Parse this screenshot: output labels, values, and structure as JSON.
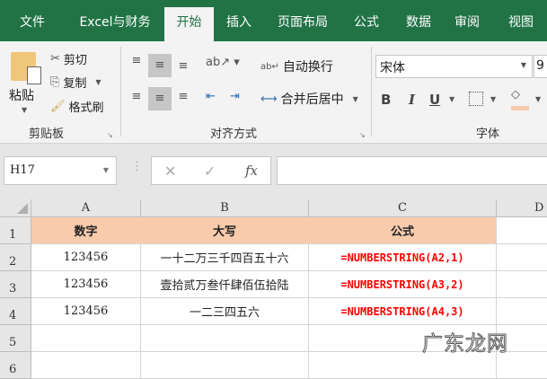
{
  "tabs": [
    "文件",
    "Excel与财务",
    "开始",
    "插入",
    "页面布局",
    "公式",
    "数据",
    "审阅",
    "视图"
  ],
  "active_tab": "开始",
  "clipboard": {
    "paste": "粘贴",
    "cut": "剪切",
    "copy": "复制",
    "format_painter": "格式刷",
    "label": "剪贴板"
  },
  "alignment": {
    "wrap_text": "自动换行",
    "merge_center": "合并后居中",
    "label": "对齐方式"
  },
  "font": {
    "name": "宋体",
    "size": "9",
    "bold": "B",
    "italic": "I",
    "underline": "U",
    "label": "字体",
    "fill_color": "#f8cbad"
  },
  "formula_bar": {
    "name_box": "H17",
    "fx": "fx",
    "value": ""
  },
  "columns": [
    "A",
    "B",
    "C",
    "D"
  ],
  "rows": [
    "1",
    "2",
    "3",
    "4",
    "5",
    "6"
  ],
  "table": {
    "header": [
      "数字",
      "大写",
      "公式"
    ],
    "data": [
      [
        "123456",
        "一十二万三千四百五十六",
        "=NUMBERSTRING(A2,1)"
      ],
      [
        "123456",
        "壹拾贰万叁仟肆佰伍拾陆",
        "=NUMBERSTRING(A3,2)"
      ],
      [
        "123456",
        "一二三四五六",
        "=NUMBERSTRING(A4,3)"
      ]
    ]
  },
  "watermark": "广东龙网",
  "colors": {
    "brand": "#217346",
    "header_fill": "#f8cbad",
    "formula_text": "#ff0000"
  }
}
